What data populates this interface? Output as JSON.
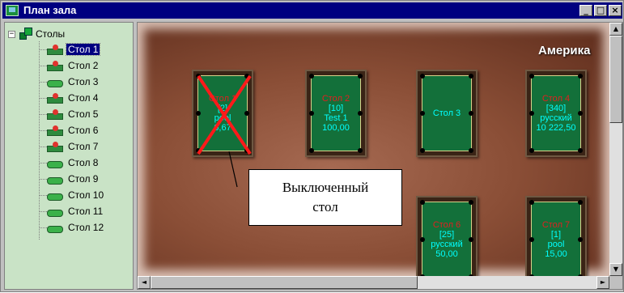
{
  "window": {
    "title": "План зала",
    "buttons": {
      "minimize": "_",
      "maximize": "□",
      "close": "×"
    }
  },
  "tree": {
    "expander": "−",
    "root_label": "Столы",
    "items": [
      {
        "label": "Стол 1",
        "status": "busy",
        "selected": true
      },
      {
        "label": "Стол 2",
        "status": "busy"
      },
      {
        "label": "Стол 3",
        "status": "free"
      },
      {
        "label": "Стол 4",
        "status": "busy"
      },
      {
        "label": "Стол 5",
        "status": "busy"
      },
      {
        "label": "Стол 6",
        "status": "busy"
      },
      {
        "label": "Стол 7",
        "status": "busy"
      },
      {
        "label": "Стол 8",
        "status": "free"
      },
      {
        "label": "Стол 9",
        "status": "free"
      },
      {
        "label": "Стол 10",
        "status": "free"
      },
      {
        "label": "Стол 11",
        "status": "free"
      },
      {
        "label": "Стол 12",
        "status": "free"
      }
    ]
  },
  "hall": {
    "title": "Америка",
    "tables": [
      {
        "name": "Стол 1",
        "count": "[2]",
        "game": "pool",
        "amount": "6,67",
        "disabled": true
      },
      {
        "name": "Стол 2",
        "count": "[10]",
        "game": "Test 1",
        "amount": "100,00"
      },
      {
        "name": "Стол 3",
        "count": "",
        "game": "",
        "amount": ""
      },
      {
        "name": "Стол 4",
        "count": "[340]",
        "game": "русский",
        "amount": "10 222,50"
      },
      {
        "name": "Стол 6",
        "count": "[25]",
        "game": "русский",
        "amount": "50,00"
      },
      {
        "name": "Стол 7",
        "count": "[1]",
        "game": "pool",
        "amount": "15,00"
      }
    ]
  },
  "callout": {
    "line1": "Выключенный",
    "line2": "стол"
  },
  "scroll": {
    "up": "▲",
    "down": "▼",
    "left": "◄",
    "right": "►"
  },
  "colors": {
    "titlebar": "#000080",
    "tree_bg": "#c9e3c6",
    "felt": "#13703a",
    "table_name_active": "#e02020",
    "table_info": "#00ffff",
    "disabled_cross": "#ff1a1a"
  }
}
